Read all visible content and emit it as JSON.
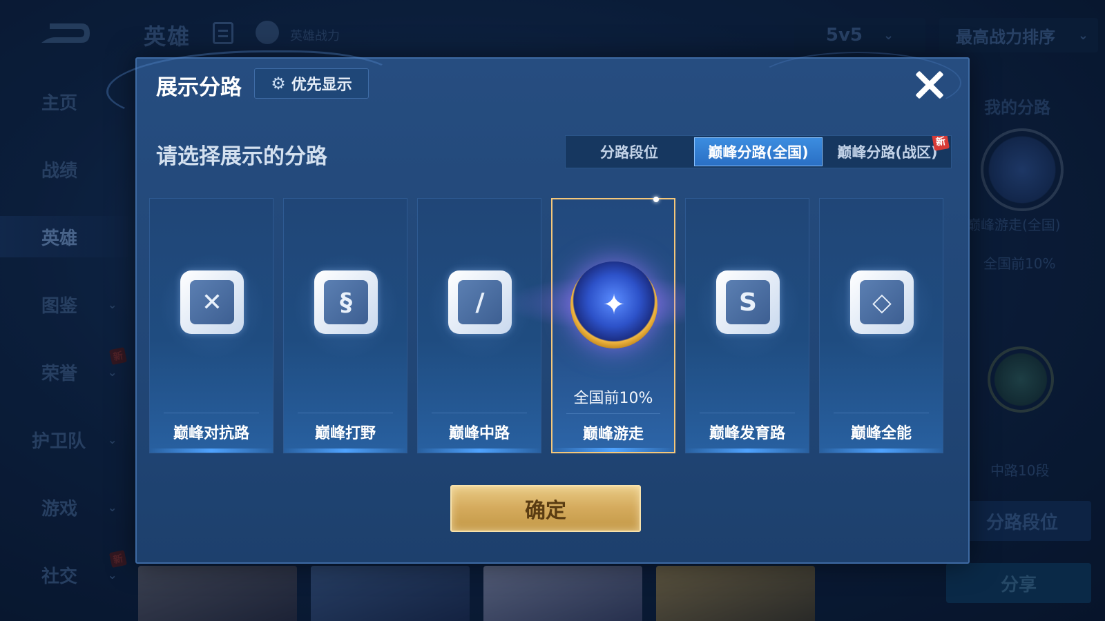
{
  "background": {
    "top_title": "英雄",
    "top_power_label": "英雄战力",
    "mode_select": "5v5",
    "sort_select": "最高战力排序",
    "sidebar": [
      {
        "label": "主页"
      },
      {
        "label": "战绩"
      },
      {
        "label": "英雄"
      },
      {
        "label": "图鉴"
      },
      {
        "label": "荣誉",
        "badge": "新"
      },
      {
        "label": "护卫队"
      },
      {
        "label": "游戏"
      },
      {
        "label": "社交",
        "badge": "新"
      }
    ],
    "right_panel": {
      "title": "我的分路",
      "lane_name": "巅峰游走(全国)",
      "lane_rank": "全国前10%",
      "mid_rank": "中路10段",
      "lane_rank_button": "分路段位",
      "share_button": "分享"
    }
  },
  "modal": {
    "title": "展示分路",
    "priority_button": "优先显示",
    "subtitle": "请选择展示的分路",
    "tabs": [
      {
        "label": "分路段位",
        "selected": false
      },
      {
        "label": "巅峰分路(全国)",
        "selected": true
      },
      {
        "label": "巅峰分路(战区)",
        "selected": false,
        "badge": "新"
      }
    ],
    "lanes": [
      {
        "name": "巅峰对抗路",
        "icon": "sword-shield-icon",
        "mark": "✕",
        "rank": "",
        "selected": false
      },
      {
        "name": "巅峰打野",
        "icon": "dragon-icon",
        "mark": "§",
        "rank": "",
        "selected": false
      },
      {
        "name": "巅峰中路",
        "icon": "slash-blade-icon",
        "mark": "/",
        "rank": "",
        "selected": false
      },
      {
        "name": "巅峰游走",
        "icon": "winged-emblem-icon",
        "mark": "✦",
        "rank": "全国前10%",
        "selected": true
      },
      {
        "name": "巅峰发育路",
        "icon": "target-icon",
        "mark": "S",
        "rank": "",
        "selected": false
      },
      {
        "name": "巅峰全能",
        "icon": "diamond-star-icon",
        "mark": "◇",
        "rank": "",
        "selected": false
      }
    ],
    "confirm_button": "确定"
  },
  "colors": {
    "accent": "#3c8de0",
    "selected_border": "#f4c77a",
    "confirm_gold": "#d4aa5c",
    "new_badge": "#d83a36"
  }
}
